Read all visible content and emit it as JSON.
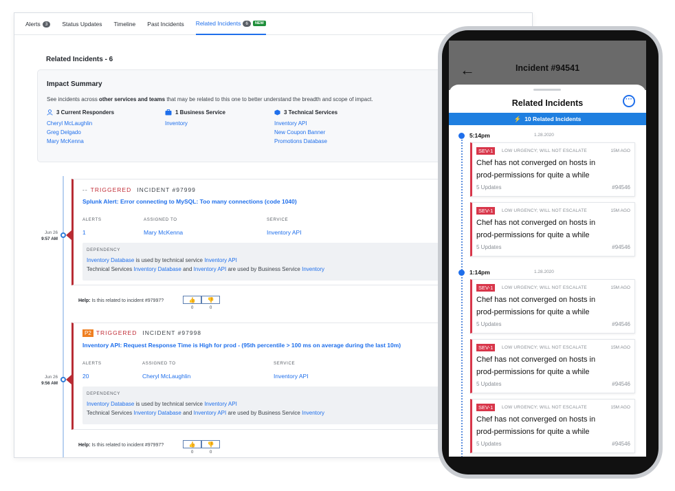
{
  "tabs": [
    {
      "label": "Alerts",
      "count": "3"
    },
    {
      "label": "Status Updates"
    },
    {
      "label": "Timeline"
    },
    {
      "label": "Past Incidents"
    },
    {
      "label": "Related Incidents",
      "count": "6",
      "badge": "NEW"
    }
  ],
  "section_title": "Related Incidents - 6",
  "impact": {
    "title": "Impact Summary",
    "desc_pre": "See incidents across ",
    "desc_bold": "other services and teams",
    "desc_post": " that may be related to this one to better understand the breadth and scope of impact.",
    "responders": {
      "label": "3 Current Responders",
      "items": [
        "Cheryl McLaughlin",
        "Greg Delgado",
        "Mary McKenna"
      ]
    },
    "business": {
      "label": "1 Business Service",
      "items": [
        "Inventory"
      ]
    },
    "technical": {
      "label": "3 Technical Services",
      "items": [
        "Inventory API",
        "New Coupon Banner",
        "Promotions Database"
      ]
    }
  },
  "incidents": [
    {
      "date": "Jun 26",
      "time": "9:57 AM",
      "priority": "--",
      "status": "TRIGGERED",
      "number": "INCIDENT #97999",
      "title": "Splunk Alert: Error connecting to MySQL: Too many connections (code 1040)",
      "labels": {
        "alerts": "ALERTS",
        "assigned": "ASSIGNED TO",
        "service": "SERVICE",
        "dependency": "DEPENDENCY"
      },
      "alerts": "1",
      "assigned": "Mary McKenna",
      "service": "Inventory API",
      "dep1": {
        "a": "Inventory Database",
        "b": " is used by technical service ",
        "c": "Inventory API"
      },
      "dep2": {
        "a": "Technical Services ",
        "b": "Inventory Database",
        "c": " and ",
        "d": "Inventory API",
        "e": " are used by Business Service ",
        "f": "Inventory"
      },
      "help_label": "Help:",
      "help_q": " Is this related to incident #97997?",
      "up": "0",
      "down": "0"
    },
    {
      "date": "Jun 26",
      "time": "9:56 AM",
      "priority": "P2",
      "status": "TRIGGERED",
      "number": "INCIDENT #97998",
      "title": "Inventory API: Request Response Time is High for prod - (95th percentile > 100 ms on average during the last 10m)",
      "labels": {
        "alerts": "ALERTS",
        "assigned": "ASSIGNED TO",
        "service": "SERVICE",
        "dependency": "DEPENDENCY"
      },
      "alerts": "20",
      "assigned": "Cheryl McLaughlin",
      "service": "Inventory API",
      "dep1": {
        "a": "Inventory Database",
        "b": " is used by technical service ",
        "c": "Inventory API"
      },
      "dep2": {
        "a": "Technical Services ",
        "b": "Inventory Database",
        "c": " and ",
        "d": "Inventory API",
        "e": " are used by Business Service ",
        "f": "Inventory"
      },
      "help_label": "Help:",
      "help_q": " Is this related to incident #97997?",
      "up": "0",
      "down": "0"
    }
  ],
  "phone": {
    "header": "Incident #94541",
    "sheet_title": "Related Incidents",
    "related_bar": "10 Related Incidents",
    "groups": [
      {
        "time": "5:14pm",
        "date": "1.28.2020"
      },
      {
        "time": "1:14pm",
        "date": "1.28.2020"
      }
    ],
    "cards": [
      {
        "sev": "SEV-1",
        "urgency": "LOW URGENCY; WILL NOT ESCALATE",
        "ago": "15M AGO",
        "title": "Chef has not converged on hosts in prod-permissions for quite a while",
        "updates": "5 Updates",
        "num": "#94546"
      },
      {
        "sev": "SEV-1",
        "urgency": "LOW URGENCY; WILL NOT ESCALATE",
        "ago": "15M AGO",
        "title": "Chef has not converged on hosts in prod-permissions for quite a while",
        "updates": "5 Updates",
        "num": "#94546"
      },
      {
        "sev": "SEV-1",
        "urgency": "LOW URGENCY; WILL NOT ESCALATE",
        "ago": "15M AGO",
        "title": "Chef has not converged on hosts in prod-permissions for quite a while",
        "updates": "5 Updates",
        "num": "#94546"
      },
      {
        "sev": "SEV-1",
        "urgency": "LOW URGENCY; WILL NOT ESCALATE",
        "ago": "15M AGO",
        "title": "Chef has not converged on hosts in prod-permissions for quite a while",
        "updates": "5 Updates",
        "num": "#94546"
      },
      {
        "sev": "SEV-1",
        "urgency": "LOW URGENCY; WILL NOT ESCALATE",
        "ago": "15M AGO",
        "title": "Chef has not converged on hosts in prod-permissions for quite a while",
        "updates": "5 Updates",
        "num": "#94546"
      }
    ]
  },
  "colors": {
    "accent": "#1f6feb",
    "triggered": "#c02b35",
    "p2": "#ef7f21",
    "sev": "#d8364a"
  }
}
